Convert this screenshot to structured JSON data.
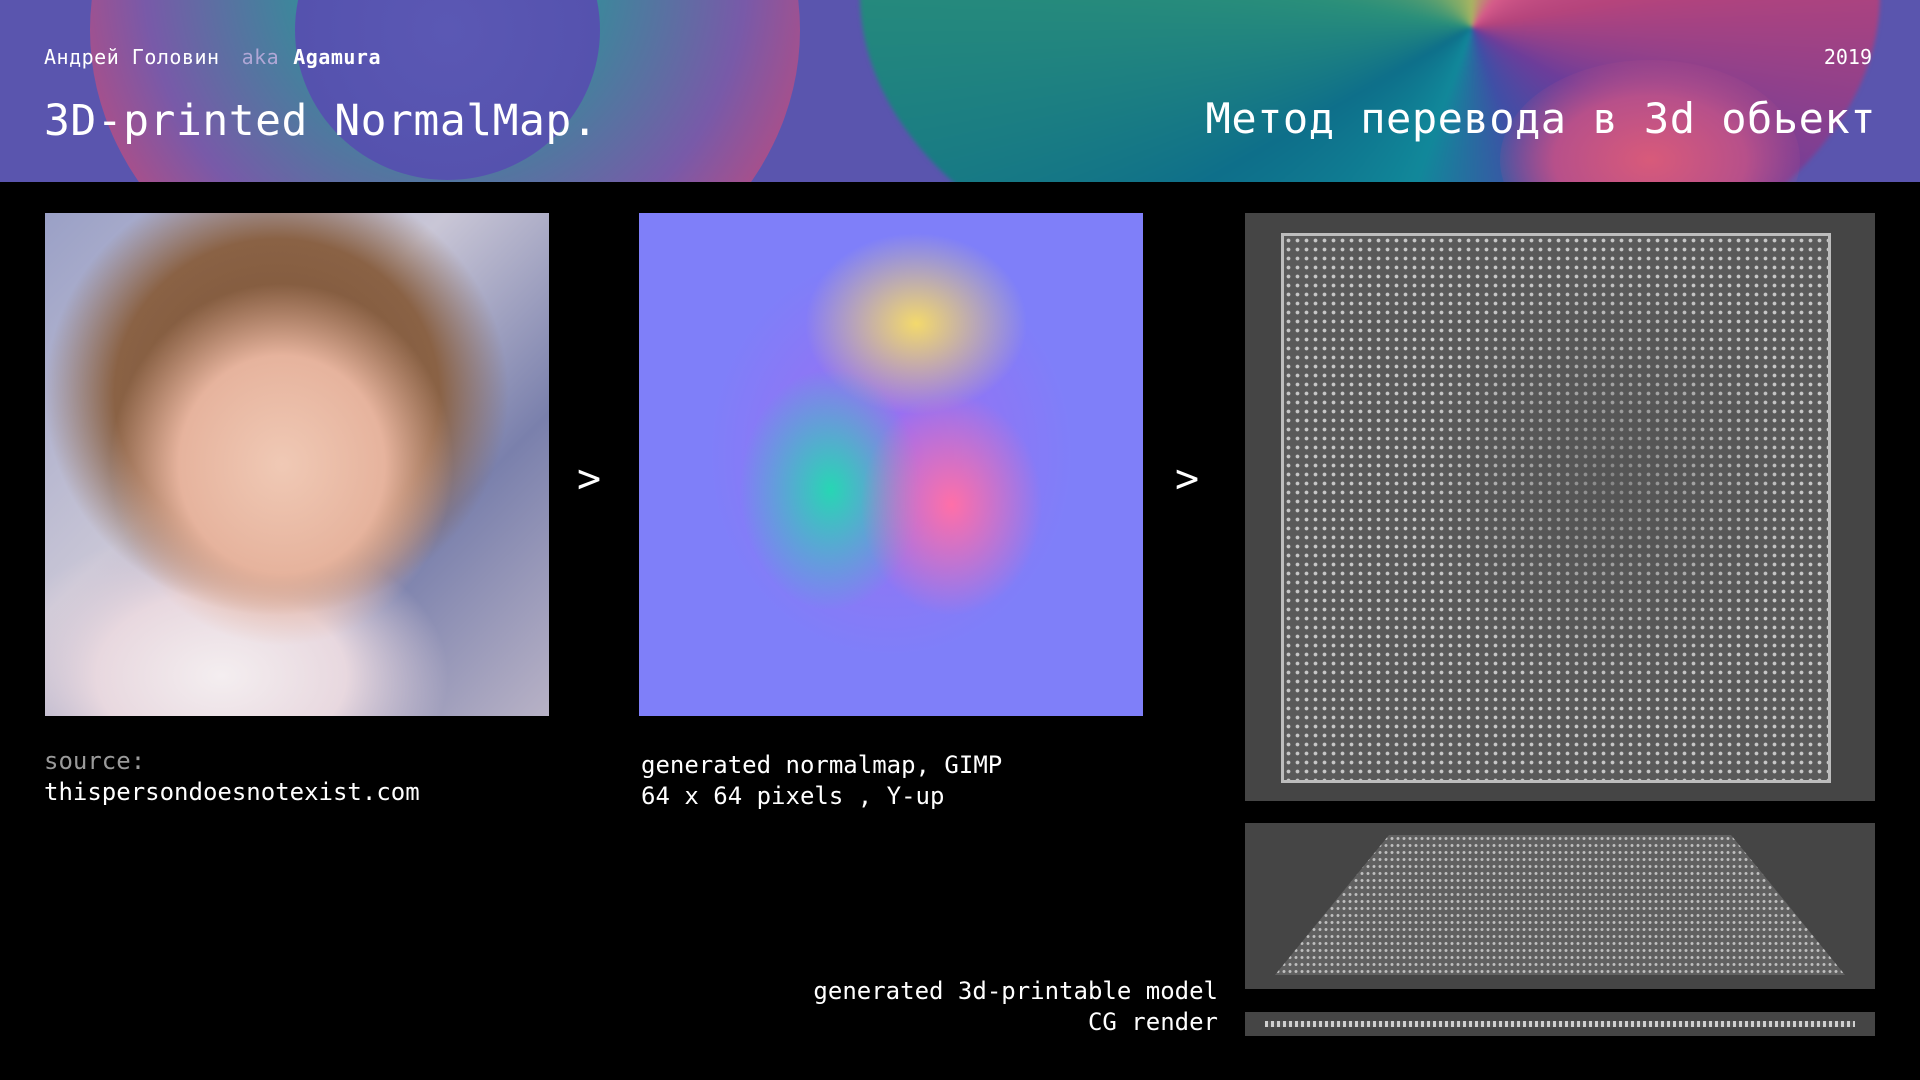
{
  "header": {
    "author_name": "Андрей Головин",
    "aka": "aka",
    "nickname": "Agamura",
    "year": "2019",
    "title": "3D-printed NormalMap.",
    "subtitle": "Метод перевода в 3d обьект"
  },
  "images": {
    "photo_icon": "child-portrait-photo",
    "normalmap_icon": "normal-map-image",
    "render_top_icon": "3d-model-top-view-render",
    "render_perspective_icon": "3d-model-perspective-render",
    "render_side_icon": "3d-model-side-view-render"
  },
  "arrows": {
    "first": ">",
    "second": ">"
  },
  "captions": {
    "source_label": "source:",
    "source_url": "thispersondoesnotexist.com",
    "normal_line1": "generated normalmap, GIMP",
    "normal_line2": "64 x 64 pixels , Y-up",
    "model_line1": "generated 3d-printable model",
    "model_line2": "CG render"
  },
  "colors": {
    "background": "#000000",
    "header_base": "#5a55ae",
    "text": "#ffffff",
    "muted": "#9a9a9a"
  }
}
